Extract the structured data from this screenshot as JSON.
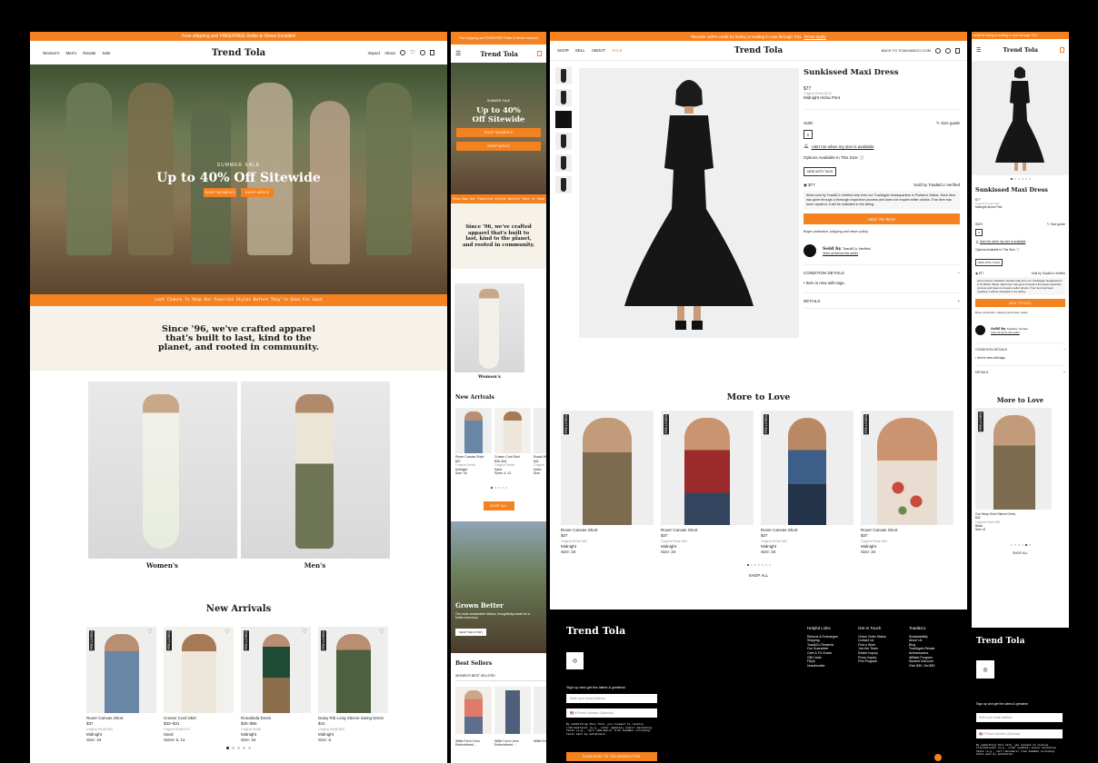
{
  "brand": "Trend Tola",
  "panel1": {
    "banner": "Free shipping and FREE/FREE Roller & Shoes Included",
    "nav_left": [
      "Women's",
      "Men's",
      "Resale",
      "Sale"
    ],
    "nav_right": [
      "Impact",
      "About"
    ],
    "hero_eyebrow": "SUMMER SALE",
    "hero_title": "Up to 40% Off Sitewide",
    "hero_btn1": "SHOP WOMEN'S",
    "hero_btn2": "SHOP MEN'S",
    "strip": "Last Chance To Shop Our Favorite Styles Before They're Gone For Good",
    "mission": "Since '96, we've crafted apparel that's built to last, kind to the planet, and rooted in community.",
    "cat_women": "Women's",
    "cat_men": "Men's",
    "new_arrivals": "New Arrivals",
    "products": [
      {
        "name": "Rover Canvas Short",
        "price": "$37",
        "orig": "Original Retail $65",
        "color": "Midnight",
        "size": "Size: 34"
      },
      {
        "name": "Cruiser Cord Skirt",
        "price": "$33–$41",
        "orig": "Original Retail $79",
        "color": "Sand",
        "size": "Sizes: 6, 12"
      },
      {
        "name": "Ronalinda Dress",
        "price": "$30–$56",
        "orig": "Original Retail",
        "color": "Midnight",
        "size": "Size: 34"
      },
      {
        "name": "Daisy Rib Long Sleeve Swing Dress",
        "price": "$41",
        "orig": "Original Retail $69",
        "color": "Midnight",
        "size": "Size: S"
      }
    ],
    "tag": "PRE-LOVED"
  },
  "panel2": {
    "banner": "Free shipping and FREE/FREE Roller & Shoes Included",
    "hero_eyebrow": "SUMMER SALE",
    "hero_title": "Up to 40% Off Sitewide",
    "btn1": "SHOP WOMEN'S",
    "btn2": "SHOP MEN'S",
    "strip": "Shop Now Our Favorite Styles Before They're Gone",
    "mission": "Since '96, we've crafted apparel that's built to last, kind to the planet, and rooted in community.",
    "cat_women": "Women's",
    "new_arrivals": "New Arrivals",
    "products": [
      {
        "name": "Rover Canvas Short",
        "price": "$37",
        "orig": "Original Retail",
        "color": "Midnight",
        "size": "Size: 34"
      },
      {
        "name": "Cruiser Cord Skirt",
        "price": "$33–$41",
        "orig": "Original Retail",
        "color": "Sand",
        "size": "Sizes: 6, 12"
      },
      {
        "name": "Rosali With",
        "price": "$41",
        "orig": "Original",
        "color": "Midni",
        "size": "Size"
      }
    ],
    "shop_all": "SHOP ALL",
    "grown_better": "Grown Better",
    "grown_text": "Our most sustainable fabrics, thoughtfully made for a better tomorrow.",
    "grown_btn": "SHOP THE STORY",
    "best_sellers": "Best Sellers",
    "best_sub": "WOMEN'S BEST SELLERS",
    "best_products": [
      {
        "name": "Willie Form Crew Embroidered ..."
      },
      {
        "name": "Willie Form Crew Embroidered ..."
      },
      {
        "name": "Willie Emb..."
      }
    ]
  },
  "panel3": {
    "banner": "Receive 100% credit for listing or trading in now through 7/31.",
    "banner_link": "Terms apply",
    "nav": [
      "SHOP",
      "SELL",
      "ABOUT"
    ],
    "nav_sale": "SALE",
    "back": "BACK TO TOADANDCO.COM",
    "title": "Sunkissed Maxi Dress",
    "price": "$77",
    "orig": "Original Retail $135",
    "color": "Midnight Aloha Print",
    "size_label": "SIZE:",
    "size_guide": "Size guide",
    "size": "S",
    "alert": "Alert me when my size is available",
    "options": "Options Available In This Size:",
    "option_tag": "NEW WITH TAGS",
    "radio_price": "$77",
    "verified": "Sold by Toad&Co Verified",
    "desc": "Items sold by Toad&Co Verified ship from our ToadAgain headquarters in Portland, Maine. Each item has gone through a thorough inspection process and does not require seller photos. If an item has been repaired, it will be indicated in the listing.",
    "add": "ADD TO BAG",
    "protect": "Buyer protection, shipping and return policy",
    "sold_by": "Sold by",
    "seller": "Toad&Co Verified",
    "view_all": "View all items this seller",
    "condition": "CONDITION DETAILS",
    "condition_item": "Item is new with tags.",
    "details": "DETAILS",
    "more": "More to Love",
    "products": [
      {
        "name": "Rover Canvas Short",
        "price": "$37",
        "orig": "Original Retail $65",
        "color": "Midnight",
        "size": "Size: 34"
      },
      {
        "name": "Rover Canvas Short",
        "price": "$37",
        "orig": "Original Retail $65",
        "color": "Midnight",
        "size": "Size: 34"
      },
      {
        "name": "Rover Canvas Short",
        "price": "$37",
        "orig": "Original Retail $65",
        "color": "Midnight",
        "size": "Size: 34"
      },
      {
        "name": "Rover Canvas Short",
        "price": "$37",
        "orig": "Original Retail $65",
        "color": "Midnight",
        "size": "Size: 34"
      }
    ],
    "shop_all": "SHOP ALL",
    "tag": "PRE-LOVED"
  },
  "footer3": {
    "brand": "Trend Tola",
    "signup": "Sign up and get the latest & greatest",
    "email_ph": "Enter your email address",
    "phone_ph": "Phone Number (Optional)",
    "legal": "By submitting this form, you consent to receive informational (e.g., order updates) and/or marketing texts (e.g., cart reminders) from Toad&Co including texts sent by autodialer.",
    "subscribe": "SUBSCRIBE TO THE NEWSLETTER",
    "cols": [
      {
        "title": "Helpful Links",
        "items": [
          "Returns & Exchanges",
          "Shipping",
          "Toad&Co Rewards",
          "Our Guarantee",
          "Care & Fit Charts",
          "Gift Cards",
          "FAQs",
          "Unsubscribe"
        ]
      },
      {
        "title": "Get In Touch",
        "items": [
          "Check Order Status",
          "Contact Us",
          "Find a Store",
          "Join the Team",
          "Dealer Inquiry",
          "Press Inquiry",
          "Film Program"
        ]
      },
      {
        "title": "Toad&Co",
        "items": [
          "Sustainability",
          "About Us",
          "Blog",
          "ToadAgain Resale",
          "Ambassadors",
          "Affiliate Program",
          "Student Discount",
          "Give $30, Get $30"
        ]
      }
    ]
  },
  "panel4": {
    "banner": "credit for listing or trading in now through 7/31",
    "title": "Sunkissed Maxi Dress",
    "price": "$77",
    "orig": "Original Retail $135",
    "color": "Midnight Aloha Print",
    "size_label": "SIZE:",
    "size_guide": "Size guide",
    "size": "S",
    "alert": "Alert me when my size is available",
    "options": "Options Available In This Size:",
    "option_tag": "NEW WITH TAGS",
    "radio_price": "$77",
    "verified": "Sold by Toad&Co Verified",
    "desc": "Items sold by Toad&Co Verified ship from our ToadAgain headquarters in Portland, Maine. Each item has gone through a thorough inspection process and does not require seller photos. If an item has been repaired, it will be indicated in the listing.",
    "add": "ADD TO BAG",
    "protect": "Buyer protection, shipping and return policy",
    "sold_by": "Sold by",
    "seller": "Toad&Co Verified",
    "view_all": "View all items this seller",
    "condition": "CONDITION DETAILS",
    "condition_item": "Item is new with tags.",
    "details": "DETAILS",
    "more": "More to Love",
    "product": {
      "name": "Cue Wrap Short Sleeve Dress",
      "price": "$42",
      "orig": "Original Retail $95",
      "color": "Black",
      "size": "Size: M"
    },
    "shop_all": "SHOP ALL",
    "footer_brand": "Trend Tola",
    "signup": "Sign up and get the latest & greatest",
    "email_ph": "Enter your email address",
    "phone_ph": "Phone Number (Optional)",
    "legal": "By submitting this form, you consent to receive informational (e.g., order updates) and/or marketing texts (e.g., cart reminders) from Toad&Co including texts sent by autodialer.",
    "tag": "PRE-LOVED"
  },
  "colors": {
    "accent": "#f58220",
    "cream": "#f6f2ea",
    "dark": "#111111"
  }
}
